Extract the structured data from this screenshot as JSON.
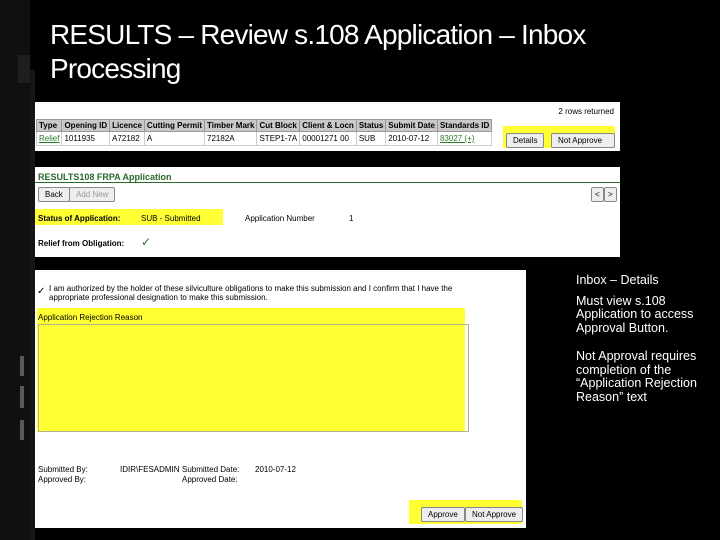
{
  "slide": {
    "title": "RESULTS – Review s.108 Application – Inbox Processing"
  },
  "inbox_table": {
    "rows_returned": "2 rows returned",
    "columns": [
      "Type",
      "Opening ID",
      "Licence",
      "Cutting Permit",
      "Timber Mark",
      "Cut Block",
      "Client & Locn",
      "Status",
      "Submit Date",
      "Standards ID"
    ],
    "row": [
      "Relief",
      "1011935",
      "A72182",
      "A",
      "72182A",
      "STEP1-7A",
      "00001271 00",
      "SUB",
      "2010-07-12",
      "83027 (+)"
    ],
    "details_label": "Details",
    "not_approve_label": "Not Approve"
  },
  "frpa": {
    "header": "RESULTS108   FRPA Application",
    "back_label": "Back",
    "add_new_label": "Add New",
    "status_label": "Status of Application:",
    "status_value": "SUB - Submitted",
    "app_number_label": "Application Number",
    "app_number_value": "1",
    "relief_label": "Relief from Obligation:",
    "relief_value": "✓"
  },
  "approval": {
    "auth_text": "I am authorized by the holder of these silviculture obligations to make this submission and I confirm that I have the appropriate professional designation to make this submission.",
    "rejection_label": "Application Rejection Reason",
    "submitted_by_label": "Submitted By:",
    "submitted_by_value": "IDIR\\FESADMIN",
    "approved_by_label": "Approved By:",
    "submitted_date_label": "Submitted Date:",
    "submitted_date_value": "2010-07-12",
    "approved_date_label": "Approved Date:",
    "approve_label": "Approve",
    "not_approve_label": "Not Approve"
  },
  "notes": {
    "line1": "Inbox – Details",
    "line2": "Must view s.108 Application to access Approval Button.",
    "line3": "Not Approval requires completion of the “Application Rejection Reason” text"
  }
}
